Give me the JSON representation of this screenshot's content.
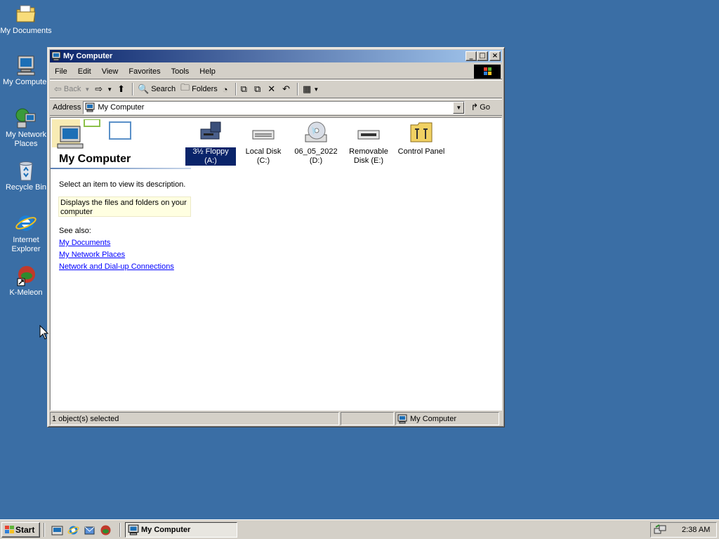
{
  "desktop": {
    "icons": [
      {
        "label": "My Documents",
        "icon": "folder-documents-icon"
      },
      {
        "label": "My Computer",
        "icon": "computer-icon"
      },
      {
        "label": "My Network Places",
        "icon": "network-places-icon"
      },
      {
        "label": "Recycle Bin",
        "icon": "recycle-bin-icon"
      },
      {
        "label": "Internet Explorer",
        "icon": "internet-explorer-icon"
      },
      {
        "label": "K-Meleon",
        "icon": "k-meleon-icon"
      }
    ]
  },
  "window": {
    "title": "My Computer",
    "menu": [
      "File",
      "Edit",
      "View",
      "Favorites",
      "Tools",
      "Help"
    ],
    "toolbar": {
      "back": "Back",
      "search": "Search",
      "folders": "Folders"
    },
    "address": {
      "label": "Address",
      "value": "My Computer",
      "go": "Go"
    },
    "side_panel": {
      "title": "My Computer",
      "prompt": "Select an item to view its description.",
      "description": "Displays the files and folders on your computer",
      "see_also": "See also:",
      "links": [
        "My Documents",
        "My Network Places",
        "Network and Dial-up Connections"
      ]
    },
    "drives": [
      {
        "label": "3½ Floppy (A:)",
        "icon": "floppy-drive-icon",
        "selected": true
      },
      {
        "label": "Local Disk (C:)",
        "icon": "hard-disk-icon",
        "selected": false
      },
      {
        "label": "06_05_2022 (D:)",
        "icon": "cd-drive-icon",
        "selected": false
      },
      {
        "label": "Removable Disk (E:)",
        "icon": "removable-disk-icon",
        "selected": false
      },
      {
        "label": "Control Panel",
        "icon": "control-panel-icon",
        "selected": false
      }
    ],
    "status": {
      "selection": "1 object(s) selected",
      "zone": "My Computer"
    }
  },
  "taskbar": {
    "start": "Start",
    "task": "My Computer",
    "clock": "2:38 AM"
  },
  "colors": {
    "desktop": "#3a6ea5",
    "title_active": "#0a246a",
    "face": "#d4d0c8"
  }
}
